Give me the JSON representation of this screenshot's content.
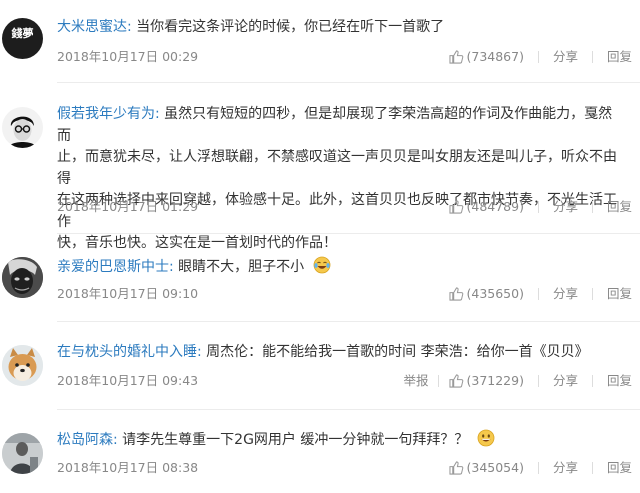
{
  "comments": [
    {
      "user": "大米思蜜达:",
      "text": "当你看完这条评论的时候，你已经在听下一首歌了",
      "time": "2018年10月17日 00:29",
      "likes": "(734867)",
      "avatar_icon": "calligraphy-avatar",
      "avatar_text": "錢夢"
    },
    {
      "user": "假若我年少有为:",
      "text_lines": [
        "虽然只有短短的四秒，但是却展现了李荣浩高超的作词及作曲能力，戛然而",
        "止，而意犹未尽，让人浮想联翩，不禁感叹道这一声贝贝是叫女朋友还是叫儿子，听众不由得",
        "在这两种选择中来回穿越，体验感十足。此外，这首贝贝也反映了都市快节奏，不光生活工作",
        "快，音乐也快。这实在是一首划时代的作品！"
      ],
      "time": "2018年10月17日 01:29",
      "likes": "(484789)",
      "avatar_icon": "person-glasses-avatar"
    },
    {
      "user": "亲爱的巴恩斯中士:",
      "text": "眼睛不大，胆子不小",
      "emoji_icon": "laughing-tears-emoji",
      "time": "2018年10月17日 09:10",
      "likes": "(435650)",
      "avatar_icon": "dark-face-avatar"
    },
    {
      "user": "在与枕头的婚礼中入睡:",
      "text": "周杰伦：能不能给我一首歌的时间 李荣浩：给你一首《贝贝》",
      "time": "2018年10月17日 09:43",
      "likes": "(371229)",
      "report_label": "举报",
      "avatar_icon": "dog-avatar"
    },
    {
      "user": "松岛阿森:",
      "text": "请李先生尊重一下2G网用户 缓冲一分钟就一句拜拜？？",
      "emoji_icon": "grinning-emoji",
      "time": "2018年10月17日 08:38",
      "likes": "(345054)",
      "avatar_icon": "person-photo-avatar"
    }
  ],
  "labels": {
    "share": "分享",
    "reply": "回复"
  },
  "colors": {
    "username": "#2c7bbf",
    "meta": "#888888",
    "divider": "#ececec"
  }
}
